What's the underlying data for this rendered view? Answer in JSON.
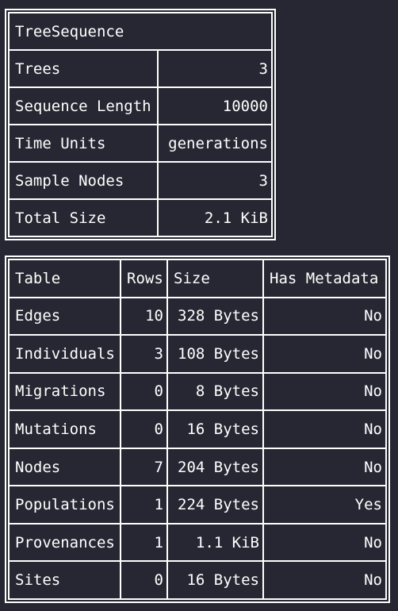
{
  "summary": {
    "header": "TreeSequence",
    "rows": [
      {
        "label": "Trees",
        "value": "3"
      },
      {
        "label": "Sequence Length",
        "value": "10000"
      },
      {
        "label": "Time Units",
        "value": "generations"
      },
      {
        "label": "Sample Nodes",
        "value": "3"
      },
      {
        "label": "Total Size",
        "value": "2.1 KiB"
      }
    ]
  },
  "tables": {
    "headers": {
      "table": "Table",
      "rows": "Rows",
      "size": "Size",
      "metadata": "Has Metadata"
    },
    "rows": [
      {
        "table": "Edges",
        "rows": "10",
        "size": "328 Bytes",
        "metadata": "No"
      },
      {
        "table": "Individuals",
        "rows": "3",
        "size": "108 Bytes",
        "metadata": "No"
      },
      {
        "table": "Migrations",
        "rows": "0",
        "size": "8 Bytes",
        "metadata": "No"
      },
      {
        "table": "Mutations",
        "rows": "0",
        "size": "16 Bytes",
        "metadata": "No"
      },
      {
        "table": "Nodes",
        "rows": "7",
        "size": "204 Bytes",
        "metadata": "No"
      },
      {
        "table": "Populations",
        "rows": "1",
        "size": "224 Bytes",
        "metadata": "Yes"
      },
      {
        "table": "Provenances",
        "rows": "1",
        "size": "1.1 KiB",
        "metadata": "No"
      },
      {
        "table": "Sites",
        "rows": "0",
        "size": "16 Bytes",
        "metadata": "No"
      }
    ]
  },
  "colors": {
    "background": "#272733",
    "foreground": "#ffffff"
  }
}
